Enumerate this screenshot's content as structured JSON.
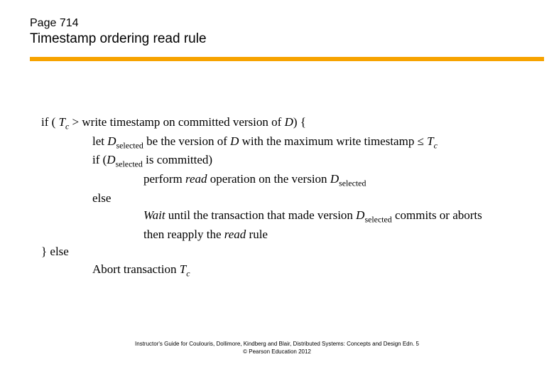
{
  "header": {
    "page_label": "Page 714",
    "title": "Timestamp ordering read rule"
  },
  "code": {
    "l1a": "if ( ",
    "l1_T": "T",
    "l1_c": "c",
    "l1b": " > write timestamp on committed version of ",
    "l1_D": "D",
    "l1c": ") {",
    "l2a": "let ",
    "l2_D": "D",
    "l2_sel": "selected",
    "l2b": " be the version of ",
    "l2_D2": "D",
    "l2c": " with the maximum write timestamp ≤ ",
    "l2_T": "T",
    "l2_cc": "c",
    "l3a": "if (",
    "l3_D": "D",
    "l3_sel": "selected",
    "l3b": " is committed)",
    "l4a": "perform ",
    "l4_read": "read",
    "l4b": " operation on the version ",
    "l4_D": "D",
    "l4_sel": "selected",
    "l5": "else",
    "l6_wait": "Wait",
    "l6a": " until the transaction that made version ",
    "l6_D": "D",
    "l6_sel": "selected",
    "l6b": " commits or aborts",
    "l7a": "then reapply the ",
    "l7_read": "read",
    "l7b": " rule",
    "l8": "} else",
    "l9a": "Abort transaction ",
    "l9_T": "T",
    "l9_c": "c"
  },
  "footer": {
    "line1": "Instructor's Guide for  Coulouris, Dollimore, Kindberg and Blair,  Distributed Systems: Concepts and Design   Edn. 5",
    "line2": "©  Pearson Education 2012"
  }
}
